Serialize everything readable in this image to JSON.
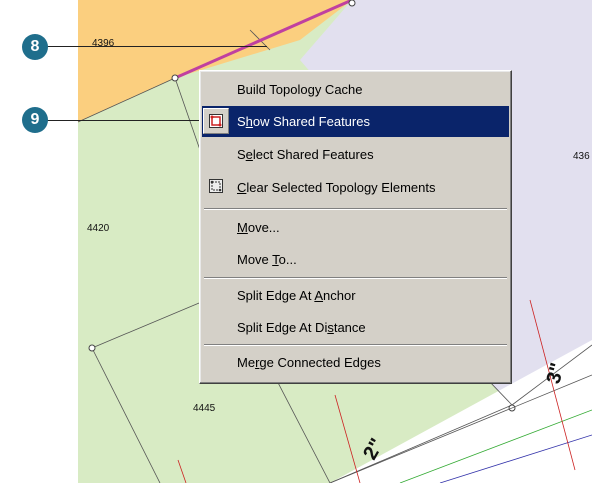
{
  "parcels": {
    "p4396": "4396",
    "p4420": "4420",
    "p4445": "4445",
    "p436": "436"
  },
  "road_labels": [
    "3\"",
    "2\""
  ],
  "callouts": {
    "c8": "8",
    "c9": "9"
  },
  "menu": {
    "items": [
      {
        "label": "Build Topology Cache"
      },
      {
        "pre": "S",
        "ul": "h",
        "post": "ow Shared Features",
        "icon": "shared-features-icon"
      },
      {
        "pre": "S",
        "ul": "e",
        "post": "lect Shared Features"
      },
      {
        "pre": "",
        "ul": "C",
        "post": "lear Selected Topology Elements",
        "icon": "clear-topology-icon"
      },
      {
        "pre": "",
        "ul": "M",
        "post": "ove..."
      },
      {
        "pre": "Move ",
        "ul": "T",
        "post": "o..."
      },
      {
        "pre": "Split Edge At ",
        "ul": "A",
        "post": "nchor"
      },
      {
        "pre": "Split Edge At Di",
        "ul": "s",
        "post": "tance"
      },
      {
        "pre": "Me",
        "ul": "r",
        "post": "ge Connected Edges"
      }
    ]
  },
  "colors": {
    "selection": "#0a246a",
    "menu_bg": "#d4d0c8",
    "parcel_green": "#d8ebc4",
    "parcel_orange": "#fbcf7f",
    "parcel_lavender": "#e2e0ef",
    "selected_edge": "#c040a0",
    "callout": "#1f6e8c"
  }
}
